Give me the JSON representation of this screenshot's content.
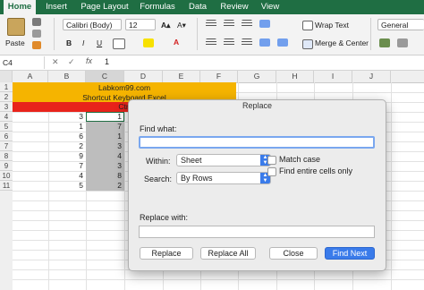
{
  "tabs": [
    "Home",
    "Insert",
    "Page Layout",
    "Formulas",
    "Data",
    "Review",
    "View"
  ],
  "ribbon": {
    "paste": "Paste",
    "font_name": "Calibri (Body)",
    "font_size": "12",
    "bold": "B",
    "italic": "I",
    "underline": "U",
    "wrap_text": "Wrap Text",
    "merge_center": "Merge & Center",
    "number_format": "General",
    "grow_font": "A▴",
    "shrink_font": "A▾",
    "font_color": "A"
  },
  "formula_bar": {
    "cell_ref": "C4",
    "cancel": "✕",
    "enter": "✓",
    "fx": "fx",
    "value": "1"
  },
  "columns": [
    "A",
    "B",
    "C",
    "D",
    "E",
    "F",
    "G",
    "H",
    "I",
    "J"
  ],
  "rows": [
    "1",
    "2",
    "3",
    "4",
    "5",
    "6",
    "7",
    "8",
    "9",
    "10",
    "11"
  ],
  "sheet": {
    "row1_text": "Labkom99.com",
    "row2_text": "Shortcut Keyboard Excel",
    "row3_text": "Ctrl",
    "colB": [
      "3",
      "1",
      "6",
      "2",
      "9",
      "7",
      "4",
      "5"
    ],
    "colC": [
      "1",
      "7",
      "1",
      "3",
      "4",
      "3",
      "8",
      "2"
    ]
  },
  "dialog": {
    "title": "Replace",
    "find_label": "Find what:",
    "find_value": "",
    "within_label": "Within:",
    "within_value": "Sheet",
    "search_label": "Search:",
    "search_value": "By Rows",
    "match_case": "Match case",
    "entire_cells": "Find entire cells only",
    "replace_label": "Replace with:",
    "replace_value": "",
    "buttons": {
      "replace": "Replace",
      "replace_all": "Replace All",
      "close": "Close",
      "find_next": "Find Next"
    }
  },
  "colors": {
    "excel_green": "#1f6e43",
    "header_orange": "#f5b400",
    "header_red": "#e8231b",
    "dialog_blue": "#3a7bea",
    "selection_gray": "#bdbdbd"
  }
}
